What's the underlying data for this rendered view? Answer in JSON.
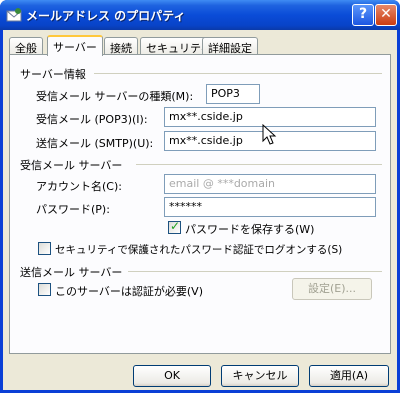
{
  "window": {
    "title": "メールアドレス のプロパティ",
    "help_label": "?",
    "close_label": "✕"
  },
  "tabs": [
    {
      "label": "全般",
      "active": false
    },
    {
      "label": "サーバー",
      "active": true
    },
    {
      "label": "接続",
      "active": false
    },
    {
      "label": "セキュリティ",
      "active": false
    },
    {
      "label": "詳細設定",
      "active": false
    }
  ],
  "server_info": {
    "group_label": "サーバー情報",
    "type_label": "受信メール サーバーの種類(M):",
    "type_value": "POP3",
    "incoming_label": "受信メール (POP3)(I):",
    "incoming_value": "mx**.cside.jp",
    "outgoing_label": "送信メール (SMTP)(U):",
    "outgoing_value": "mx**.cside.jp"
  },
  "incoming_server": {
    "group_label": "受信メール サーバー",
    "account_label": "アカウント名(C):",
    "account_value": "email @ ***domain",
    "password_label": "パスワード(P):",
    "password_value": "******",
    "save_password_label": "パスワードを保存する(W)",
    "save_password_checked": true,
    "spa_label": "セキュリティで保護されたパスワード認証でログオンする(S)",
    "spa_checked": false
  },
  "outgoing_server": {
    "group_label": "送信メール サーバー",
    "auth_label": "このサーバーは認証が必要(V)",
    "auth_checked": false,
    "settings_label": "設定(E)..."
  },
  "buttons": {
    "ok": "OK",
    "cancel": "キャンセル",
    "apply": "適用(A)"
  }
}
